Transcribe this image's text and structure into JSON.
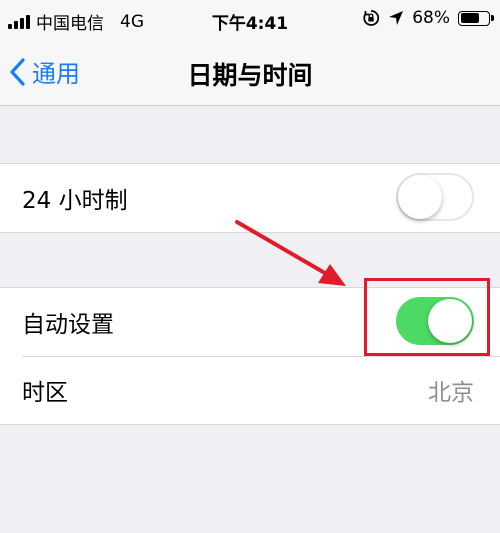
{
  "status_bar": {
    "carrier": "中国电信",
    "network": "4G",
    "time": "下午4:41",
    "battery_text": "68%",
    "battery_level": 0.68
  },
  "nav": {
    "back_label": "通用",
    "title": "日期与时间"
  },
  "settings": {
    "hour24_label": "24 小时制",
    "hour24_on": false,
    "auto_set_label": "自动设置",
    "auto_set_on": true,
    "timezone_label": "时区",
    "timezone_value": "北京"
  },
  "colors": {
    "accent": "#1a7cf7",
    "toggle_on": "#4cd964",
    "annotation": "#e21b2b"
  }
}
